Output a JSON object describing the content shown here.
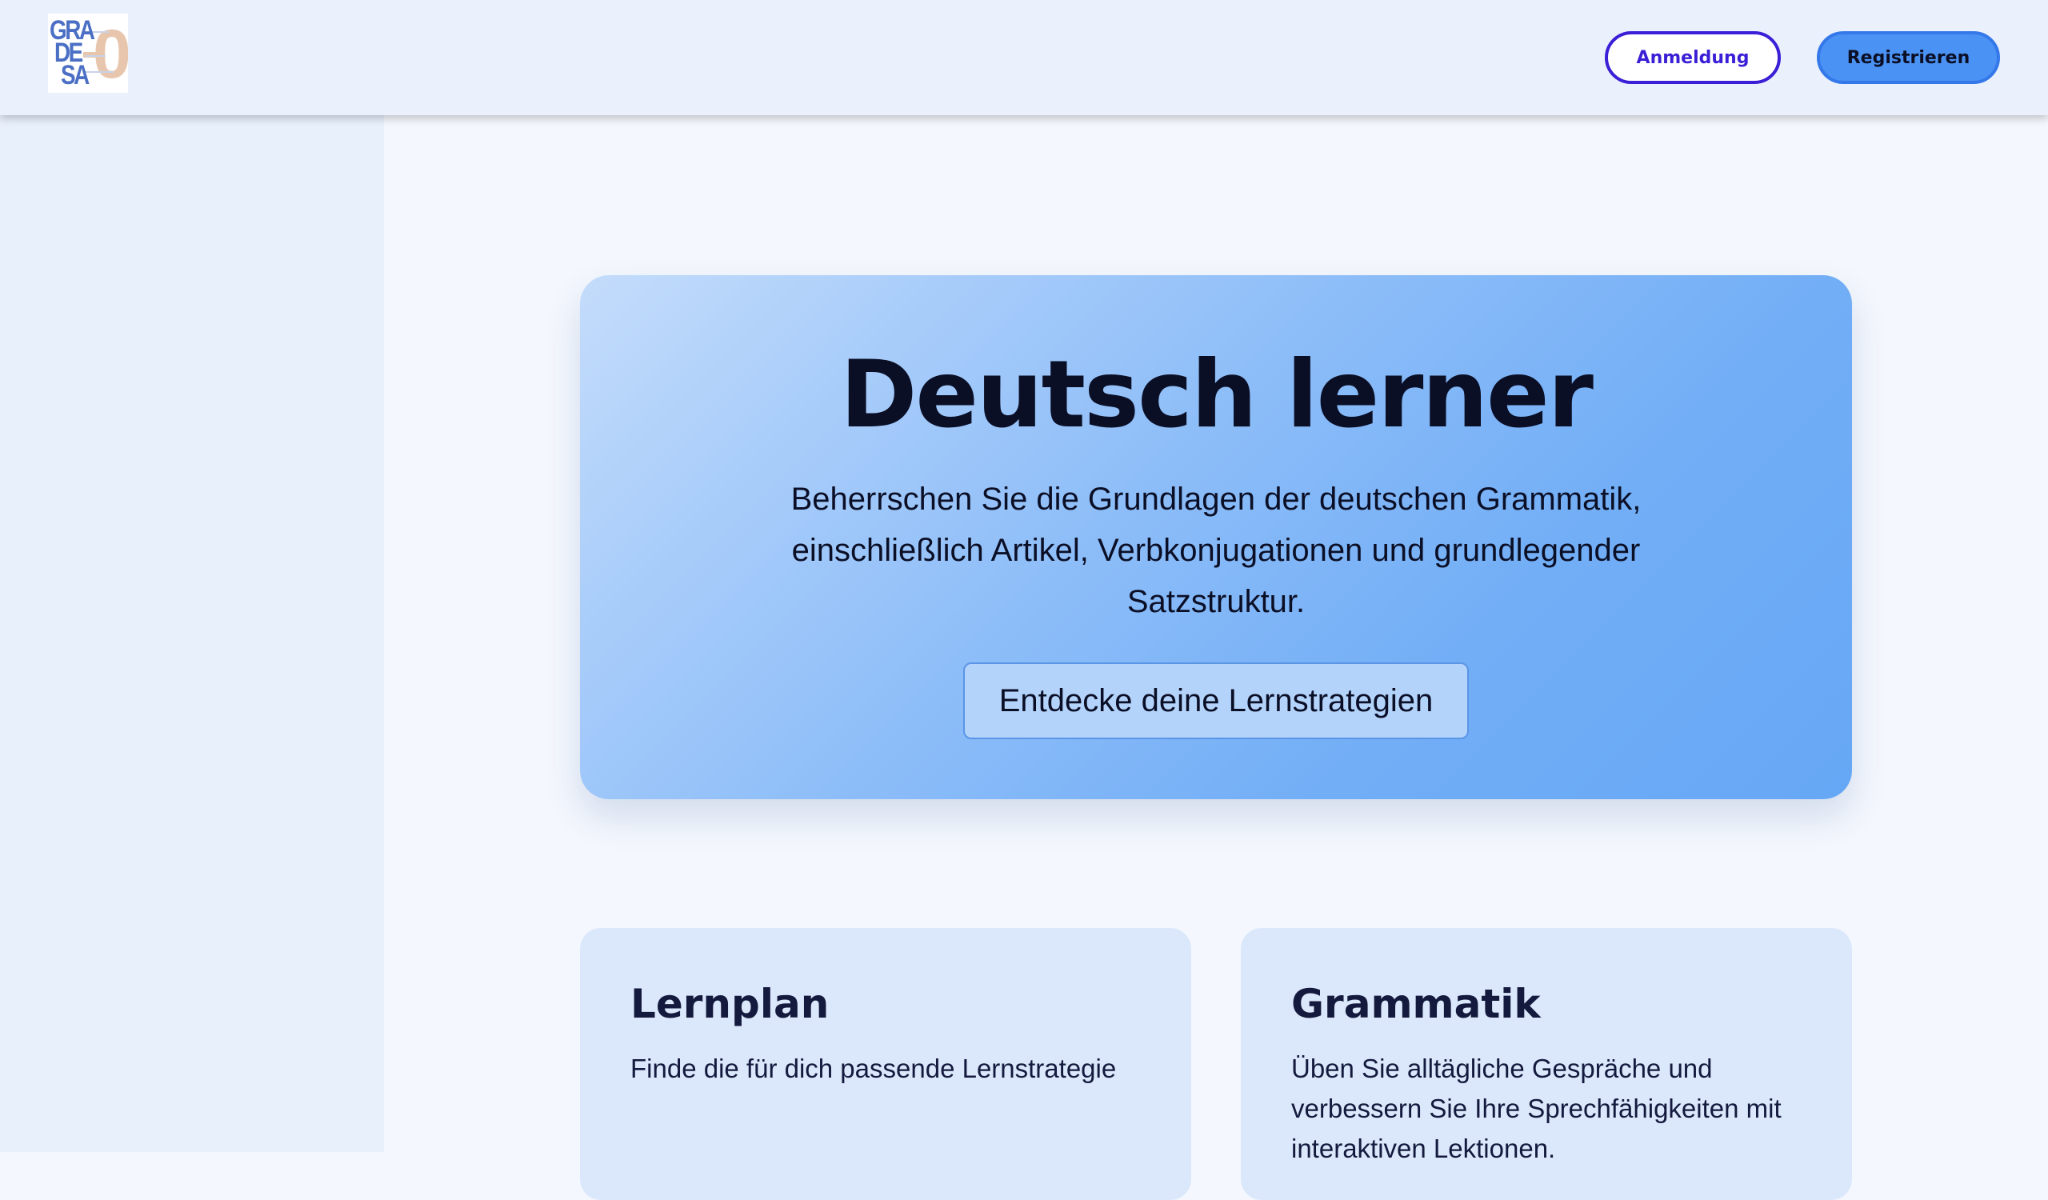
{
  "logo": {
    "lines": [
      "GRA",
      "DE",
      "SA"
    ],
    "digit": "0"
  },
  "header": {
    "login_label": "Anmeldung",
    "register_label": "Registrieren"
  },
  "hero": {
    "title": "Deutsch lerner",
    "description": "Beherrschen Sie die Grundlagen der deutschen Grammatik, einschließlich Artikel, Verbkonjugationen und grundlegender Satzstruktur.",
    "cta_label": "Entdecke deine Lernstrategien"
  },
  "cards": [
    {
      "title": "Lernplan",
      "text": "Finde die für dich passende Lernstrategie"
    },
    {
      "title": "Grammatik",
      "text": "Üben Sie alltägliche Gespräche und verbessern Sie Ihre Sprechfähigkeiten mit interaktiven Lektionen."
    }
  ],
  "colors": {
    "accent_primary": "#3a1fd6",
    "accent_button": "#4a92f3",
    "hero_gradient_start": "#c4dcfb",
    "hero_gradient_end": "#66a7f5"
  }
}
